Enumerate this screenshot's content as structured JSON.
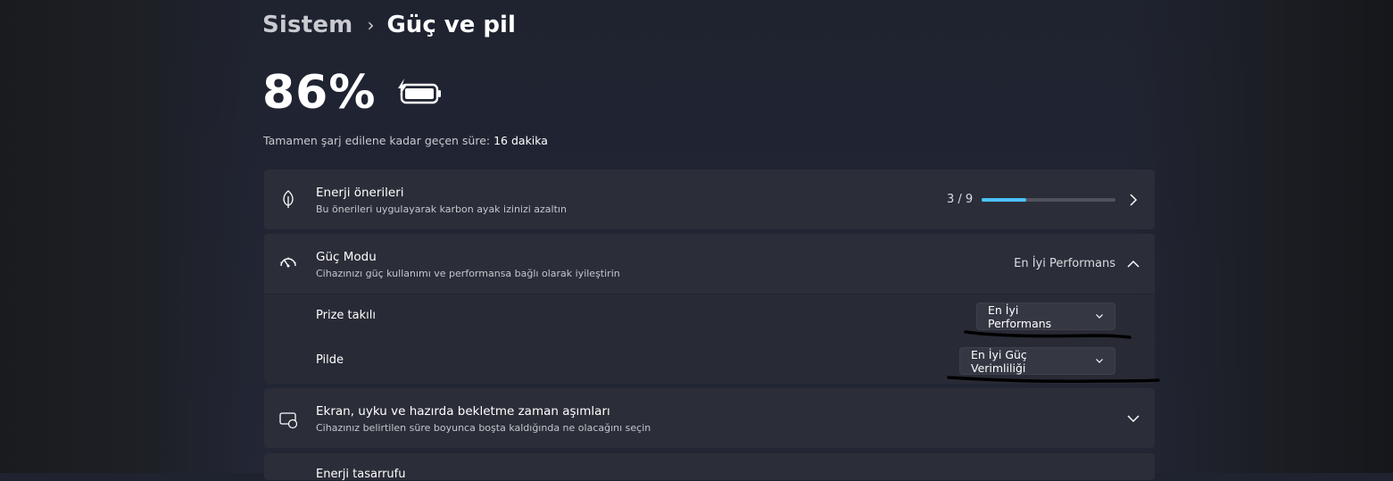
{
  "breadcrumb": {
    "parent": "Sistem",
    "separator": "›",
    "current": "Güç ve pil"
  },
  "battery": {
    "percent": "86%",
    "percent_value": 86,
    "charging": true,
    "charge_time_label": "Tamamen şarj edilene kadar geçen süre:",
    "charge_time_value": "16 dakika"
  },
  "energy_recommendations": {
    "title": "Enerji önerileri",
    "description": "Bu önerileri uygulayarak karbon ayak izinizi azaltın",
    "progress_text": "3 / 9",
    "progress_done": 3,
    "progress_total": 9,
    "icon": "leaf-icon"
  },
  "power_mode": {
    "title": "Güç Modu",
    "description": "Cihazınızı güç kullanımı ve performansa bağlı olarak iyileştirin",
    "current_value": "En İyi Performans",
    "icon": "gauge-icon",
    "expanded": true,
    "rows": [
      {
        "label": "Prize takılı",
        "selected": "En İyi Performans"
      },
      {
        "label": "Pilde",
        "selected": "En İyi Güç Verimliliği"
      }
    ]
  },
  "screen_sleep": {
    "title": "Ekran, uyku ve hazırda bekletme zaman aşımları",
    "description": "Cihazınız belirtilen süre boyunca boşta kaldığında ne olacağını seçin",
    "icon": "screen-sleep-icon"
  },
  "next_card": {
    "title": "Enerji tasarrufu"
  },
  "colors": {
    "accent": "#4cc2ff",
    "card": "#2b2e38",
    "background": "#202432"
  }
}
